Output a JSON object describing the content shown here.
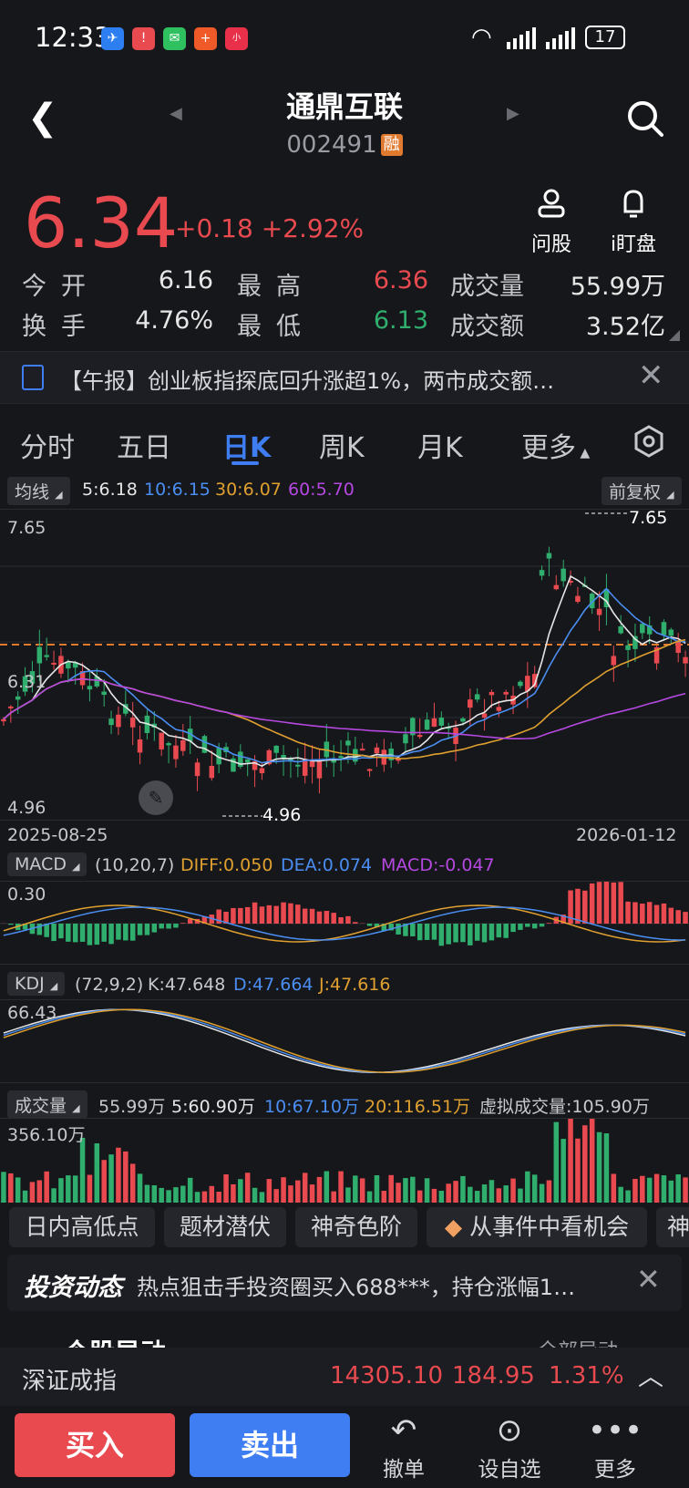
{
  "status_bar": {
    "time": "12:33",
    "battery": "17"
  },
  "header": {
    "name": "通鼎互联",
    "code": "002491",
    "margin_badge": "融"
  },
  "quote": {
    "price": "6.34",
    "change": "+0.18",
    "change_pct": "+2.92%",
    "open_label": "今开",
    "open": "6.16",
    "high_label": "最高",
    "high": "6.36",
    "volume_label": "成交量",
    "volume": "55.99万",
    "turnover_label": "换手",
    "turnover": "4.76%",
    "low_label": "最低",
    "low": "6.13",
    "amount_label": "成交额",
    "amount": "3.52亿"
  },
  "quick_actions": {
    "ask": "问股",
    "watch": "i盯盘"
  },
  "news_banner": "【午报】创业板指探底回升涨超1%，两市成交额…",
  "tabs": [
    "分时",
    "五日",
    "日K",
    "周K",
    "月K",
    "更多"
  ],
  "ma_bar": {
    "label": "均线",
    "ma5": "5:6.18",
    "ma10": "10:6.15",
    "ma30": "30:6.07",
    "ma60": "60:5.70",
    "adjust": "前复权"
  },
  "kline": {
    "y_top": "7.65",
    "y_mid": "6.31",
    "y_bottom": "4.96",
    "max_marker": "7.65",
    "min_marker": "4.96",
    "date_start": "2025-08-25",
    "date_end": "2026-01-12"
  },
  "macd": {
    "label": "MACD",
    "params": "(10,20,7)",
    "diff": "DIFF:0.050",
    "dea": "DEA:0.074",
    "macd": "MACD:-0.047",
    "y_top": "0.30"
  },
  "kdj": {
    "label": "KDJ",
    "params": "(72,9,2)",
    "k": "K:47.648",
    "d": "D:47.664",
    "j": "J:47.616",
    "y_top": "66.43"
  },
  "vol": {
    "label": "成交量",
    "v": "55.99万",
    "v5": "5:60.90万",
    "v10": "10:67.10万",
    "v20": "20:116.51万",
    "virtual": "虚拟成交量:105.90万",
    "y_top": "356.10万"
  },
  "chips": [
    "日内高低点",
    "题材潜伏",
    "神奇色阶",
    "从事件中看机会",
    "神"
  ],
  "invest_banner": {
    "logo": "投资动态",
    "text": "热点狙击手投资圈买入688***，持仓涨幅1…"
  },
  "section_peek": {
    "left": "个股异动",
    "right": "全部异动"
  },
  "index_bar": {
    "name": "深证成指",
    "value": "14305.10",
    "change": "184.95",
    "pct": "1.31%"
  },
  "bottom": {
    "buy": "买入",
    "sell": "卖出",
    "cancel": "撤单",
    "watchlist": "设自选",
    "more": "更多"
  },
  "colors": {
    "up": "#e84a4f",
    "down": "#2fae6d",
    "accent": "#3f7ef2",
    "ma30": "#e0a030",
    "ma60": "#b548e0"
  }
}
